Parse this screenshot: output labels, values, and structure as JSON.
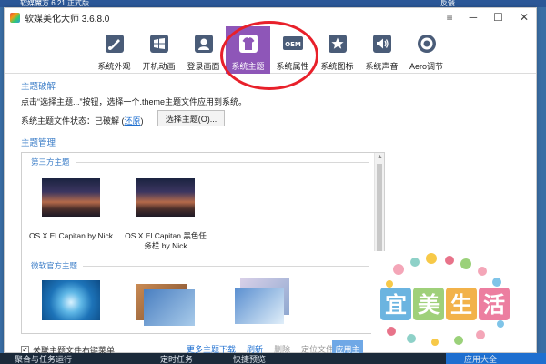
{
  "background": {
    "top_left_text": "软媒魔方 6.21 正式版",
    "top_right_text": "反馈"
  },
  "window": {
    "title": "软媒美化大师 3.6.8.0",
    "controls": [
      "≡",
      "─",
      "☐",
      "✕"
    ]
  },
  "toolbar": {
    "items": [
      {
        "label": "系统外观",
        "icon": "brush-icon"
      },
      {
        "label": "开机动画",
        "icon": "windows-logo-icon"
      },
      {
        "label": "登录画面",
        "icon": "portrait-icon"
      },
      {
        "label": "系统主题",
        "icon": "tshirt-icon",
        "active": true
      },
      {
        "label": "系统属性",
        "icon": "oem-icon"
      },
      {
        "label": "系统图标",
        "icon": "star-icon"
      },
      {
        "label": "系统声音",
        "icon": "speaker-icon"
      },
      {
        "label": "Aero调节",
        "icon": "aero-ring-icon"
      }
    ],
    "active_color": "#8e56b8",
    "highlight_circle_color": "#e8202a"
  },
  "crack": {
    "title": "主题破解",
    "hint": "点击“选择主题...”按钮，选择一个.theme主题文件应用到系统。",
    "status_label": "系统主题文件状态：已破解 (",
    "restore_link": "还原",
    "status_suffix": ")",
    "choose_button": "选择主题(O)..."
  },
  "manage": {
    "title": "主题管理",
    "groups": [
      {
        "name": "第三方主题",
        "themes": [
          {
            "caption": "OS X El Capitan by Nick"
          },
          {
            "caption": "OS X El Capitan 黑色任务栏 by Nick"
          }
        ]
      },
      {
        "name": "微软官方主题",
        "themes": []
      }
    ]
  },
  "bottom": {
    "checkbox_label": "关联主题文件右键菜单",
    "checkbox_checked": "✓",
    "more_link": "更多主题下载",
    "refresh_link": "刷新",
    "delete_link": "删除",
    "locate_link": "定位文件",
    "apply_button": "应用主"
  },
  "taskbar": {
    "item1": "聚合与任务运行",
    "item2": "定时任务",
    "item3": "快捷预览",
    "item4": "应用大全"
  },
  "watermark": {
    "text": "宜美生活"
  }
}
